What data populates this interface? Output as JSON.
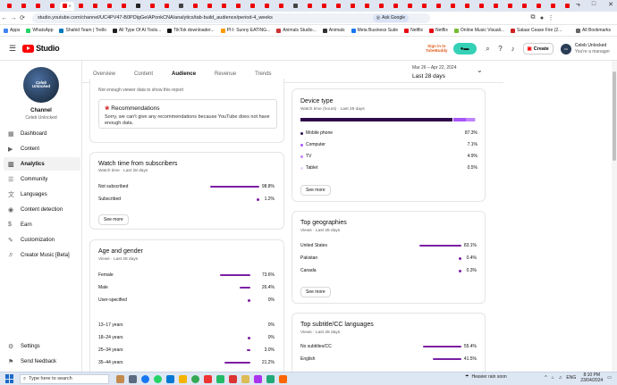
{
  "browser": {
    "url": "studio.youtube.com/channel/UC4PV47-B0PDlgGeIAPonkCNA/analytics/tab-build_audience/period-4_weeks",
    "ask_google": "Ask Google",
    "bookmarks": [
      "Apps",
      "WhatsApp",
      "Shahid Team | Trello",
      "All Type Of AI Tools...",
      "TikTok downloader...",
      "PI-I: Sunny EATING...",
      "Animals Studio...",
      "Animals",
      "Meta Business Suite",
      "Netflix",
      "Netflix",
      "Online Music Visuali...",
      "Salaar Cease Fire (2...",
      "All Bookmarks"
    ]
  },
  "header": {
    "studio_label": "Studio",
    "tubebuddy_line1": "Sign in to",
    "tubebuddy_line2": "TubeBuddy",
    "create_label": "Create",
    "account_name": "Celeb Unlocked",
    "account_sub": "You're a manager"
  },
  "sidebar": {
    "avatar_line1": "Celeb",
    "avatar_line2": "Unlocked",
    "channel_label": "Channel",
    "channel_name": "Celeb Unlocked",
    "items": [
      {
        "label": "Dashboard",
        "icon": "dashboard-icon"
      },
      {
        "label": "Content",
        "icon": "content-icon"
      },
      {
        "label": "Analytics",
        "icon": "analytics-icon"
      },
      {
        "label": "Community",
        "icon": "community-icon"
      },
      {
        "label": "Languages",
        "icon": "languages-icon"
      },
      {
        "label": "Content detection",
        "icon": "content-detection-icon"
      },
      {
        "label": "Earn",
        "icon": "earn-icon"
      },
      {
        "label": "Customization",
        "icon": "customization-icon"
      },
      {
        "label": "Creator Music [Beta]",
        "icon": "creator-music-icon"
      }
    ],
    "settings_label": "Settings",
    "feedback_label": "Send feedback"
  },
  "tabs": [
    "Overview",
    "Content",
    "Audience",
    "Revenue",
    "Trends"
  ],
  "date_range": {
    "range": "Mar 26 – Apr 22, 2024",
    "label": "Last 28 days"
  },
  "recommendations": {
    "not_enough": "Not enough viewer data to show this report",
    "title": "Recommendations",
    "body": "Sorry, we can't give any recommendations because YouTube does not have enough data."
  },
  "watch_time_subs": {
    "title": "Watch time from subscribers",
    "subtitle": "Watch time · Last 28 days",
    "rows": [
      {
        "label": "Not subscribed",
        "value": "98.8%",
        "pct": 98.8
      },
      {
        "label": "Subscribed",
        "value": "1.2%",
        "pct": 1.2
      }
    ],
    "see_more": "See more"
  },
  "age_gender": {
    "title": "Age and gender",
    "subtitle": "Views · Last 28 days",
    "gender_rows": [
      {
        "label": "Female",
        "value": "73.6%",
        "pct": 73.6
      },
      {
        "label": "Male",
        "value": "26.4%",
        "pct": 26.4
      },
      {
        "label": "User-specified",
        "value": "0%",
        "pct": 0
      }
    ],
    "age_rows": [
      {
        "label": "13–17 years",
        "value": "0%",
        "pct": 0
      },
      {
        "label": "18–24 years",
        "value": "0%",
        "pct": 0
      },
      {
        "label": "25–34 years",
        "value": "3.0%",
        "pct": 3.0
      },
      {
        "label": "35–44 years",
        "value": "21.2%",
        "pct": 21.2
      }
    ]
  },
  "device_type": {
    "title": "Device type",
    "subtitle": "Watch time (hours) · Last 28 days",
    "rows": [
      {
        "label": "Mobile phone",
        "value": "87.3%",
        "pct": 87.3,
        "color": "#2f0a4b"
      },
      {
        "label": "Computer",
        "value": "7.1%",
        "pct": 7.1,
        "color": "#a855f7"
      },
      {
        "label": "TV",
        "value": "4.9%",
        "pct": 4.9,
        "color": "#c084fc"
      },
      {
        "label": "Tablet",
        "value": "0.5%",
        "pct": 0.5,
        "color": "#e9d5ff"
      }
    ],
    "see_more": "See more"
  },
  "top_geographies": {
    "title": "Top geographies",
    "subtitle": "Views · Last 28 days",
    "rows": [
      {
        "label": "United States",
        "value": "83.1%",
        "pct": 83.1
      },
      {
        "label": "Pakistan",
        "value": "0.4%",
        "pct": 0.4
      },
      {
        "label": "Canada",
        "value": "0.3%",
        "pct": 0.3
      }
    ],
    "see_more": "See more"
  },
  "top_subtitles": {
    "title": "Top subtitle/CC languages",
    "subtitle": "Views · Last 28 days",
    "rows": [
      {
        "label": "No subtitles/CC",
        "value": "55.4%",
        "pct": 55.4
      },
      {
        "label": "English",
        "value": "41.5%",
        "pct": 41.5
      }
    ]
  },
  "taskbar": {
    "search_placeholder": "Type here to search",
    "weather": "Heavier rain soon",
    "lang": "ENG",
    "time": "8:10 PM",
    "date": "23/04/2024"
  },
  "colors": {
    "bar": "#7c1fa3",
    "youtube_red": "#ff0000",
    "tubebuddy": "#35d1b6"
  }
}
